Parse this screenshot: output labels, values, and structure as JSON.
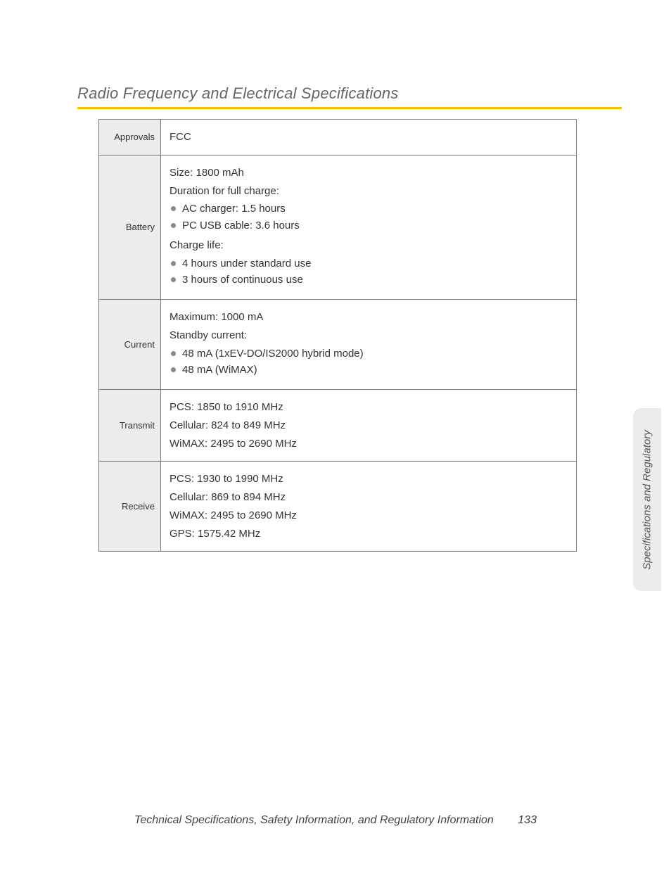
{
  "section_title": "Radio Frequency and Electrical Specifications",
  "table": {
    "approvals": {
      "label": "Approvals",
      "value": "FCC"
    },
    "battery": {
      "label": "Battery",
      "size": "Size: 1800 mAh",
      "duration_heading": "Duration for full charge:",
      "duration_items": [
        "AC charger: 1.5 hours",
        "PC USB cable: 3.6 hours"
      ],
      "charge_heading": "Charge life:",
      "charge_items": [
        "4 hours under standard use",
        "3 hours of continuous use"
      ]
    },
    "current": {
      "label": "Current",
      "max": "Maximum: 1000 mA",
      "standby_heading": "Standby current:",
      "standby_items": [
        "48 mA (1xEV-DO/IS2000 hybrid mode)",
        "48 mA (WiMAX)"
      ]
    },
    "transmit": {
      "label": "Transmit",
      "lines": [
        "PCS: 1850 to 1910 MHz",
        "Cellular: 824 to 849 MHz",
        "WiMAX: 2495 to 2690 MHz"
      ]
    },
    "receive": {
      "label": "Receive",
      "lines": [
        "PCS: 1930 to 1990 MHz",
        "Cellular: 869 to 894 MHz",
        "WiMAX: 2495 to 2690 MHz",
        "GPS: 1575.42 MHz"
      ]
    }
  },
  "side_tab": "Specifications and Regulatory",
  "footer": {
    "text": "Technical Specifications, Safety Information, and Regulatory Information",
    "page": "133"
  }
}
